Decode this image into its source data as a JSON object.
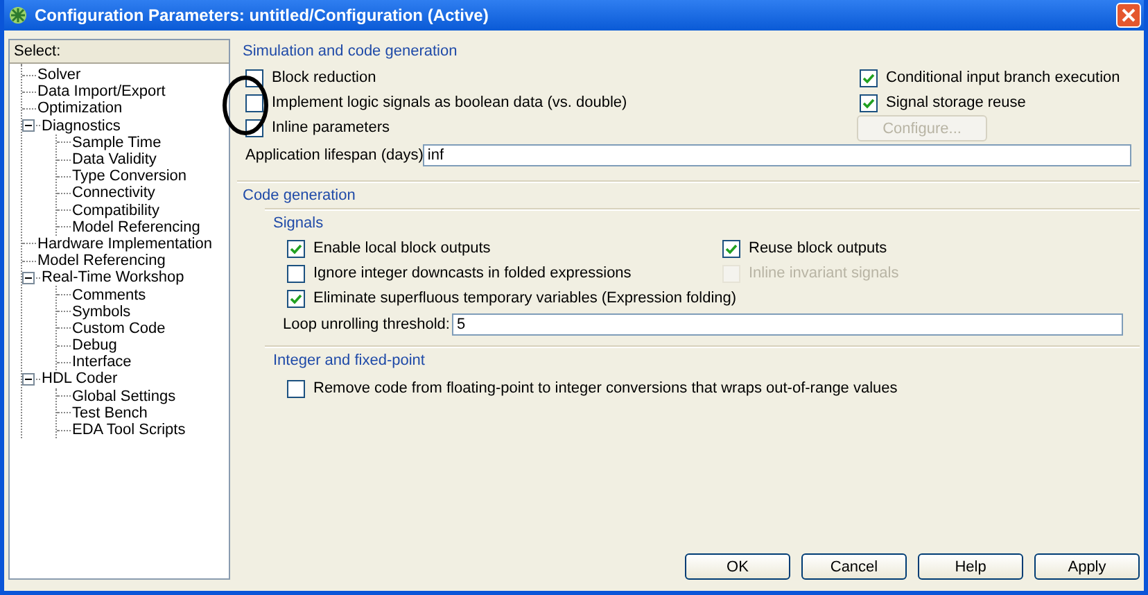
{
  "window": {
    "title": "Configuration Parameters: untitled/Configuration (Active)"
  },
  "tree": {
    "header": "Select:",
    "items": [
      {
        "label": "Solver"
      },
      {
        "label": "Data Import/Export"
      },
      {
        "label": "Optimization"
      },
      {
        "label": "Diagnostics",
        "expanded": true,
        "children": [
          {
            "label": "Sample Time"
          },
          {
            "label": "Data Validity"
          },
          {
            "label": "Type Conversion"
          },
          {
            "label": "Connectivity"
          },
          {
            "label": "Compatibility"
          },
          {
            "label": "Model Referencing"
          }
        ]
      },
      {
        "label": "Hardware Implementation"
      },
      {
        "label": "Model Referencing"
      },
      {
        "label": "Real-Time Workshop",
        "expanded": true,
        "children": [
          {
            "label": "Comments"
          },
          {
            "label": "Symbols"
          },
          {
            "label": "Custom Code"
          },
          {
            "label": "Debug"
          },
          {
            "label": "Interface"
          }
        ]
      },
      {
        "label": "HDL Coder",
        "expanded": true,
        "children": [
          {
            "label": "Global Settings"
          },
          {
            "label": "Test Bench"
          },
          {
            "label": "EDA Tool Scripts"
          }
        ]
      }
    ]
  },
  "simulation": {
    "title": "Simulation and code generation",
    "left": [
      {
        "label": "Block reduction",
        "checked": false
      },
      {
        "label": "Implement logic signals as boolean data (vs. double)",
        "checked": false
      },
      {
        "label": "Inline parameters",
        "checked": false
      }
    ],
    "right": [
      {
        "label": "Conditional input branch execution",
        "checked": true
      },
      {
        "label": "Signal storage reuse",
        "checked": true
      }
    ],
    "configure_button": {
      "label": "Configure...",
      "disabled": true
    },
    "lifespan": {
      "label": "Application lifespan (days)",
      "value": "inf"
    }
  },
  "code_generation": {
    "title": "Code generation",
    "signals": {
      "title": "Signals",
      "rows": [
        [
          {
            "label": "Enable local block outputs",
            "checked": true,
            "disabled": false
          },
          {
            "label": "Reuse block outputs",
            "checked": true,
            "disabled": false
          }
        ],
        [
          {
            "label": "Ignore integer downcasts in folded expressions",
            "checked": false,
            "disabled": false
          },
          {
            "label": "Inline invariant signals",
            "checked": false,
            "disabled": true
          }
        ],
        [
          {
            "label": "Eliminate superfluous temporary variables (Expression folding)",
            "checked": true,
            "disabled": false
          }
        ]
      ],
      "loop": {
        "label": "Loop unrolling threshold:",
        "value": "5"
      }
    },
    "integer": {
      "title": "Integer and fixed-point",
      "options": [
        {
          "label": "Remove code from floating-point to integer conversions that wraps out-of-range values",
          "checked": false
        }
      ]
    }
  },
  "buttons": [
    "OK",
    "Cancel",
    "Help",
    "Apply"
  ],
  "annotation": {
    "kind": "ellipse"
  }
}
